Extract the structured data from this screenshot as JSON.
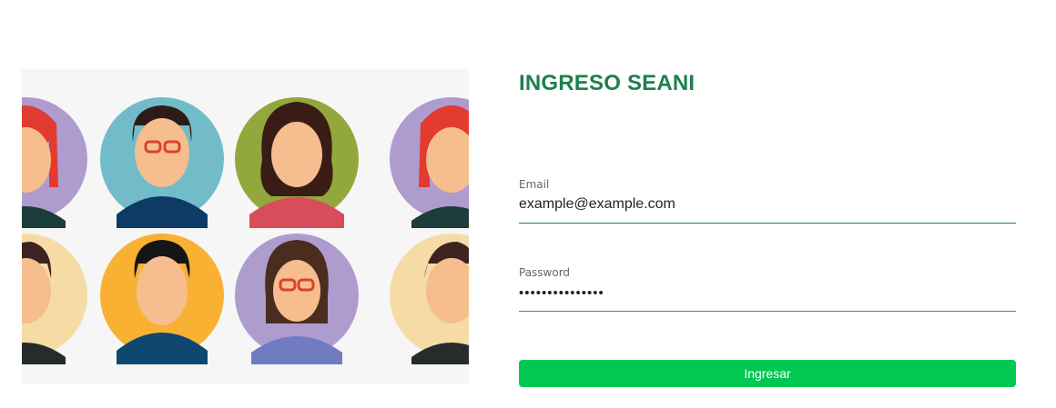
{
  "title": "INGRESO SEANI",
  "email": {
    "label": "Email",
    "value": "example@example.com"
  },
  "password": {
    "label": "Password",
    "value": "•••••••••••••••"
  },
  "submit_label": "Ingresar",
  "colors": {
    "title": "#1e7f4d",
    "button": "#00c853",
    "email_underline": "#1e7f4d",
    "password_underline": "#777777"
  },
  "hero_image": {
    "icon": "avatar-grid-illustration",
    "avatar_background_colors": [
      "#ae9ccf",
      "#71bcc8",
      "#93a83c",
      "#ae9ccf",
      "#f6dba5",
      "#f8b133",
      "#ae9ccf",
      "#f6dba5"
    ]
  }
}
